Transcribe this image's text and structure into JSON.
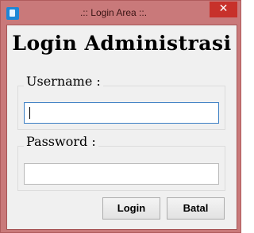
{
  "window": {
    "title": ".:: Login Area ::.",
    "close_glyph": "✕",
    "colors": {
      "frame": "#c9797a",
      "close": "#c7312b",
      "client": "#f0f0f0"
    },
    "icons": {
      "app": "app-icon",
      "close": "close-icon"
    }
  },
  "form": {
    "heading": "Login Administrasi",
    "username_label": "Username :",
    "username_value": "",
    "password_label": "Password :",
    "password_value": "",
    "login_label": "Login",
    "cancel_label": "Batal"
  }
}
